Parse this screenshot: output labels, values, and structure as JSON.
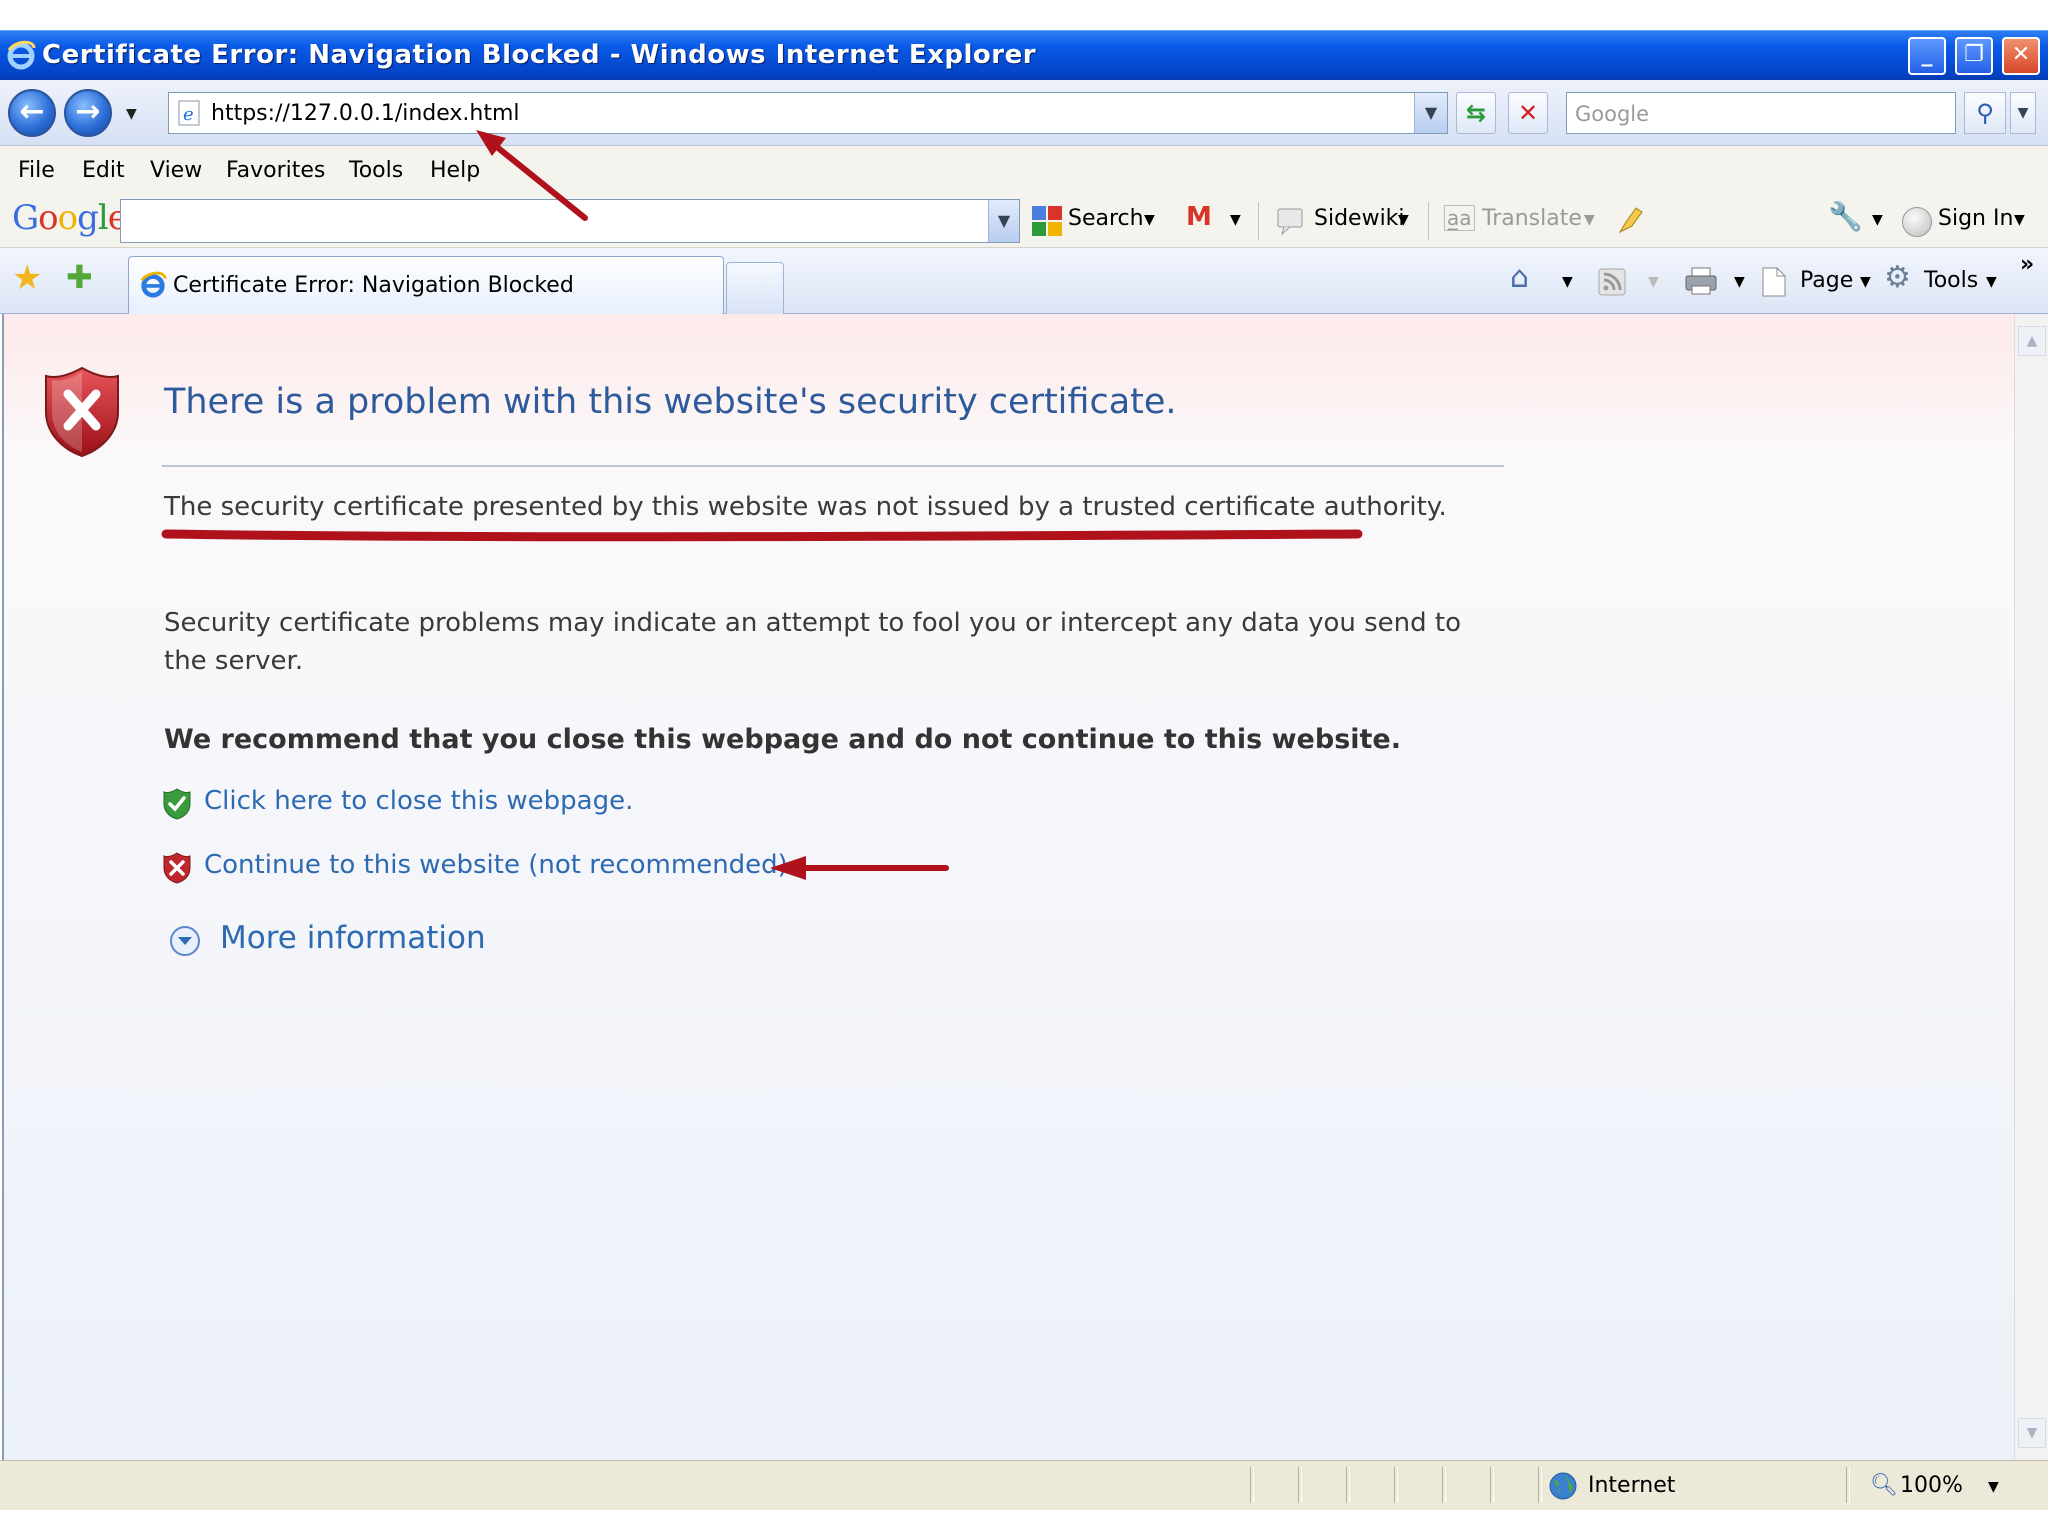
{
  "window": {
    "title": "Certificate Error: Navigation Blocked - Windows Internet Explorer",
    "buttons": {
      "minimize": "_",
      "restore": "❐",
      "close": "✕"
    }
  },
  "address_bar": {
    "url": "https://127.0.0.1/index.html",
    "search_placeholder": "Google"
  },
  "menu": [
    "File",
    "Edit",
    "View",
    "Favorites",
    "Tools",
    "Help"
  ],
  "google_toolbar": {
    "logo": "Google",
    "search_label": "Search",
    "sidewiki_label": "Sidewiki",
    "translate_label": "Translate",
    "sign_in_label": "Sign In"
  },
  "tabs": {
    "active_title": "Certificate Error: Navigation Blocked"
  },
  "command_bar": {
    "page_label": "Page",
    "tools_label": "Tools",
    "overflow": "»"
  },
  "content": {
    "heading": "There is a problem with this website's security certificate.",
    "cert_issue": "The security certificate presented by this website was not issued by a trusted certificate authority.",
    "warning": "Security certificate problems may indicate an attempt to fool you or intercept any data you send to the server.",
    "recommendation": "We recommend that you close this webpage and do not continue to this website.",
    "close_link": "Click here to close this webpage.",
    "continue_link": "Continue to this website (not recommended).",
    "more_info": "More information"
  },
  "status_bar": {
    "zone": "Internet",
    "zoom": "100%"
  },
  "colors": {
    "annotation_red": "#b0121b",
    "link_blue": "#2e6ab1",
    "heading_blue": "#2d5a9a"
  }
}
